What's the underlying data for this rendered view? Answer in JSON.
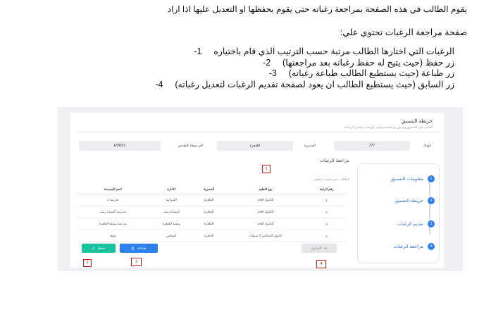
{
  "document": {
    "paragraph1": "يقوم الطالب في هذه الصفحة بمراجعة رغباته حتى يقوم بحفظها او التعديل عليها اذا اراد",
    "paragraph2": "صفحة مراجعة الرغبات تحتوي علي:",
    "items": [
      {
        "num": "-1",
        "text": "الرغبات التي اختارها الطالب مرتبة حسب الترتيب الذي قام باختياره"
      },
      {
        "num": "-2",
        "text": "زر حفظ (حيث يتيح له حفظ رغباته بعد مراجعتها)"
      },
      {
        "num": "-3",
        "text": "زر طباعة (حيث يستطيع الطالب طباعة رغباته)"
      },
      {
        "num": "-4",
        "text": "زر السابق (حيث يستطيع الطالب ان يعود لصفحة تقديم الرغبات لتعديل رغباته)"
      }
    ]
  },
  "screenshot": {
    "header_title": "خريطة التنسيق",
    "header_subtitle": "التقدم على التنسيق وعرض تم التقديم وعلى الرغبات وتعديل الرغبات",
    "fields": {
      "code_label": "كودك",
      "code_value": "277",
      "directorate_label": "المديرية",
      "directorate_value": "القاهرة",
      "deadline_label": "اخر ميعاد للتقديم",
      "deadline_value": "6/30/21"
    },
    "steps": [
      {
        "num": "1",
        "label": "معلومات التنسيق"
      },
      {
        "num": "2",
        "label": "خريطة التنسيق"
      },
      {
        "num": "3",
        "label": "تقديم الرغبات"
      },
      {
        "num": "4",
        "label": "مراجعة الرغبات"
      }
    ],
    "section_title": "مراجعة الرغبات",
    "student_line": "الطالب: عمر محمد ابراهيم",
    "table": {
      "headers": [
        "رقم الرغبة",
        "نوع التعليم",
        "المديرية",
        "الادارة",
        "اسم المدرسة"
      ],
      "rows": [
        [
          "1",
          "الثانوي العام",
          "القاهرة",
          "الشرابية",
          "مدرسة 1"
        ],
        [
          "2",
          "الثانوي العام",
          "القاهرة",
          "السيدة زينب",
          "مدرسة السيدة زينب"
        ],
        [
          "3",
          "الثانوي العام",
          "القاهرة",
          "وسط القاهرة",
          "مدرسة وسط القاهرة"
        ],
        [
          "4",
          "الثانوي الصناعي 3 سنوات",
          "القاهرة",
          "الوطني",
          "Test"
        ]
      ]
    },
    "buttons": {
      "save": "حفظ",
      "print": "طباعة",
      "previous": "السابق"
    },
    "markers": [
      "1",
      "2",
      "3",
      "4"
    ],
    "colors": {
      "primary": "#2f80ed",
      "save": "#19c3a0",
      "marker": "#d01616"
    }
  }
}
